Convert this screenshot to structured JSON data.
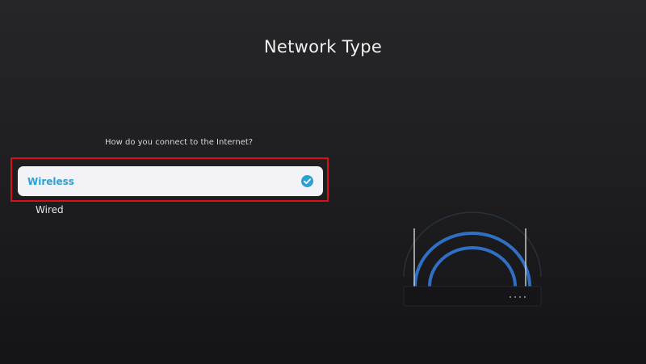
{
  "page": {
    "title": "Network Type",
    "question": "How do you connect to the Internet?"
  },
  "options": [
    {
      "label": "Wireless",
      "selected": true
    },
    {
      "label": "Wired",
      "selected": false
    }
  ],
  "colors": {
    "accent": "#2aa1d4",
    "highlight_border": "#d6101c",
    "background": "#1f1f21"
  },
  "icons": {
    "check": "check-circle-icon",
    "illustration": "router-wifi-illustration"
  }
}
